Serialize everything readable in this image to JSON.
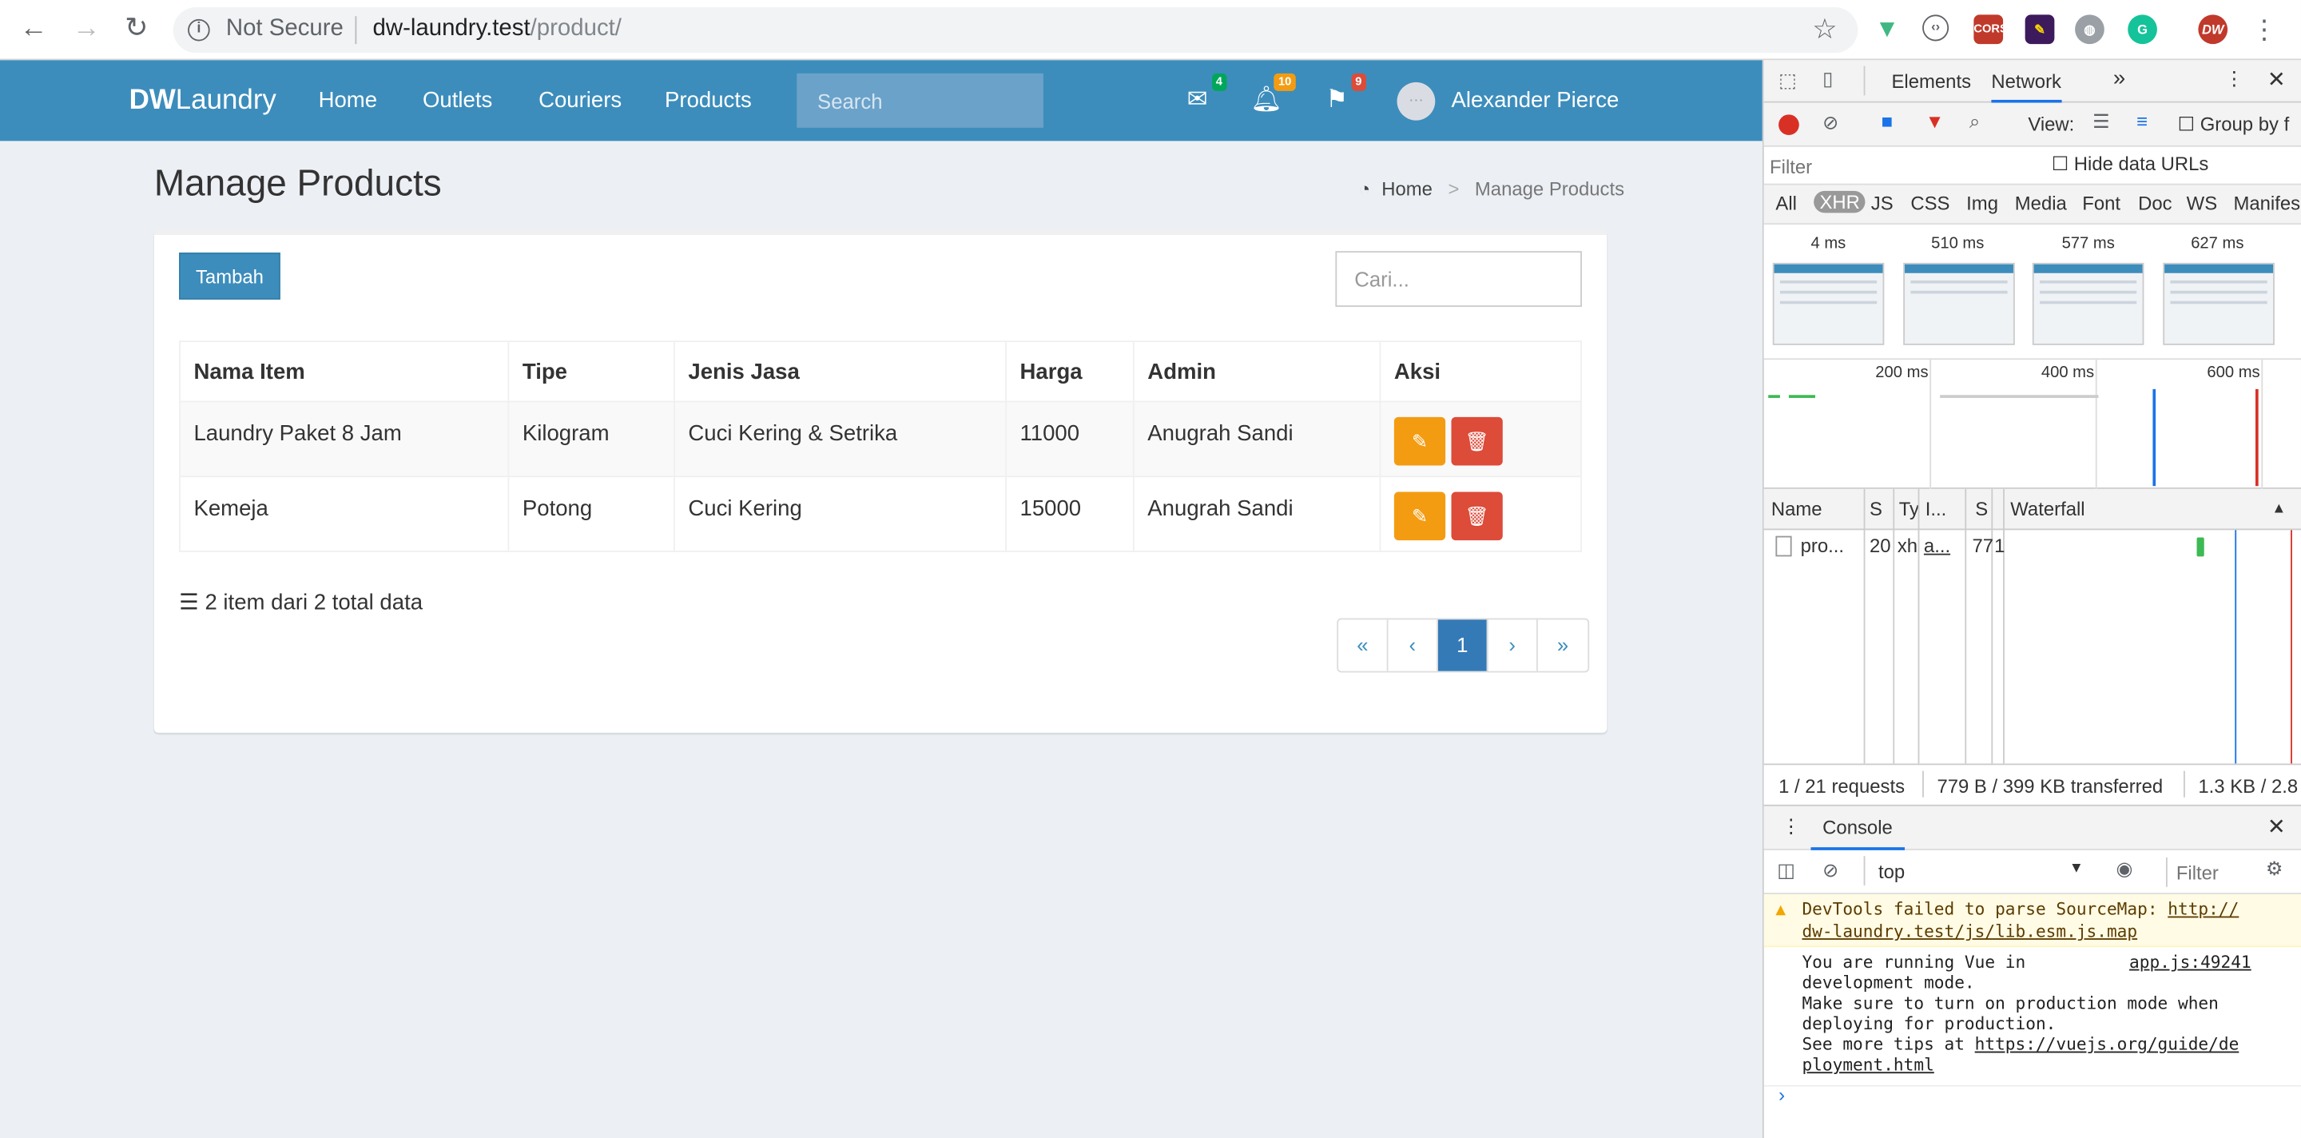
{
  "browser": {
    "security_label": "Not Secure",
    "url_host": "dw-laundry.test",
    "url_path": "/product/"
  },
  "navbar": {
    "brand_bold": "DW",
    "brand_rest": "Laundry",
    "links": [
      "Home",
      "Outlets",
      "Couriers",
      "Products"
    ],
    "search_placeholder": "Search",
    "messages_count": "4",
    "notifications_count": "10",
    "flags_count": "9",
    "user_name": "Alexander Pierce"
  },
  "page": {
    "title": "Manage Products",
    "breadcrumb_home": "Home",
    "breadcrumb_current": "Manage Products",
    "add_button": "Tambah",
    "search_placeholder": "Cari...",
    "columns": [
      "Nama Item",
      "Tipe",
      "Jenis Jasa",
      "Harga",
      "Admin",
      "Aksi"
    ],
    "rows": [
      {
        "nama": "Laundry Paket 8 Jam",
        "tipe": "Kilogram",
        "jasa": "Cuci Kering & Setrika",
        "harga": "11000",
        "admin": "Anugrah Sandi"
      },
      {
        "nama": "Kemeja",
        "tipe": "Potong",
        "jasa": "Cuci Kering",
        "harga": "15000",
        "admin": "Anugrah Sandi"
      }
    ],
    "summary": "2 item dari 2 total data",
    "pagination": {
      "first": "«",
      "prev": "‹",
      "current": "1",
      "next": "›",
      "last": "»"
    }
  },
  "devtools": {
    "tabs": [
      "Elements",
      "Network"
    ],
    "view_label": "View:",
    "group_by": "Group by f",
    "filter_placeholder": "Filter",
    "hide_data_urls": "Hide data URLs",
    "types": [
      "All",
      "XHR",
      "JS",
      "CSS",
      "Img",
      "Media",
      "Font",
      "Doc",
      "WS",
      "Manifes"
    ],
    "film_times": [
      "4 ms",
      "510 ms",
      "577 ms",
      "627 ms"
    ],
    "timeline_labels": [
      "200 ms",
      "400 ms",
      "600 ms"
    ],
    "columns": [
      "Name",
      "S",
      "Ty",
      "I...",
      "S",
      "Waterfall"
    ],
    "request": {
      "name": "pro...",
      "status": "20",
      "type": "xh",
      "initiator": "a...",
      "size": "77",
      "time": "1"
    },
    "status_requests": "1 / 21 requests",
    "status_transferred": "779 B / 399 KB transferred",
    "status_resources": "1.3 KB / 2.8",
    "console": {
      "tab": "Console",
      "context": "top",
      "filter_placeholder": "Filter",
      "warning_text": "DevTools failed to parse SourceMap: ",
      "warning_link_1": "http://",
      "warning_link_2": "dw-laundry.test/js/lib.esm.js.map",
      "msg_line_1": "You are running Vue in",
      "msg_source": "app.js:49241",
      "msg_line_2": "development mode.",
      "msg_line_3": "Make sure to turn on production mode when",
      "msg_line_4": "deploying for production.",
      "msg_line_5": "See more tips at ",
      "msg_link_1": "https://vuejs.org/guide/de",
      "msg_link_2": "ployment.html"
    }
  },
  "colors": {
    "brand": "#3c8dbc",
    "edit": "#f39c12",
    "delete": "#dd4b39",
    "xhr_badge": "#999999"
  }
}
